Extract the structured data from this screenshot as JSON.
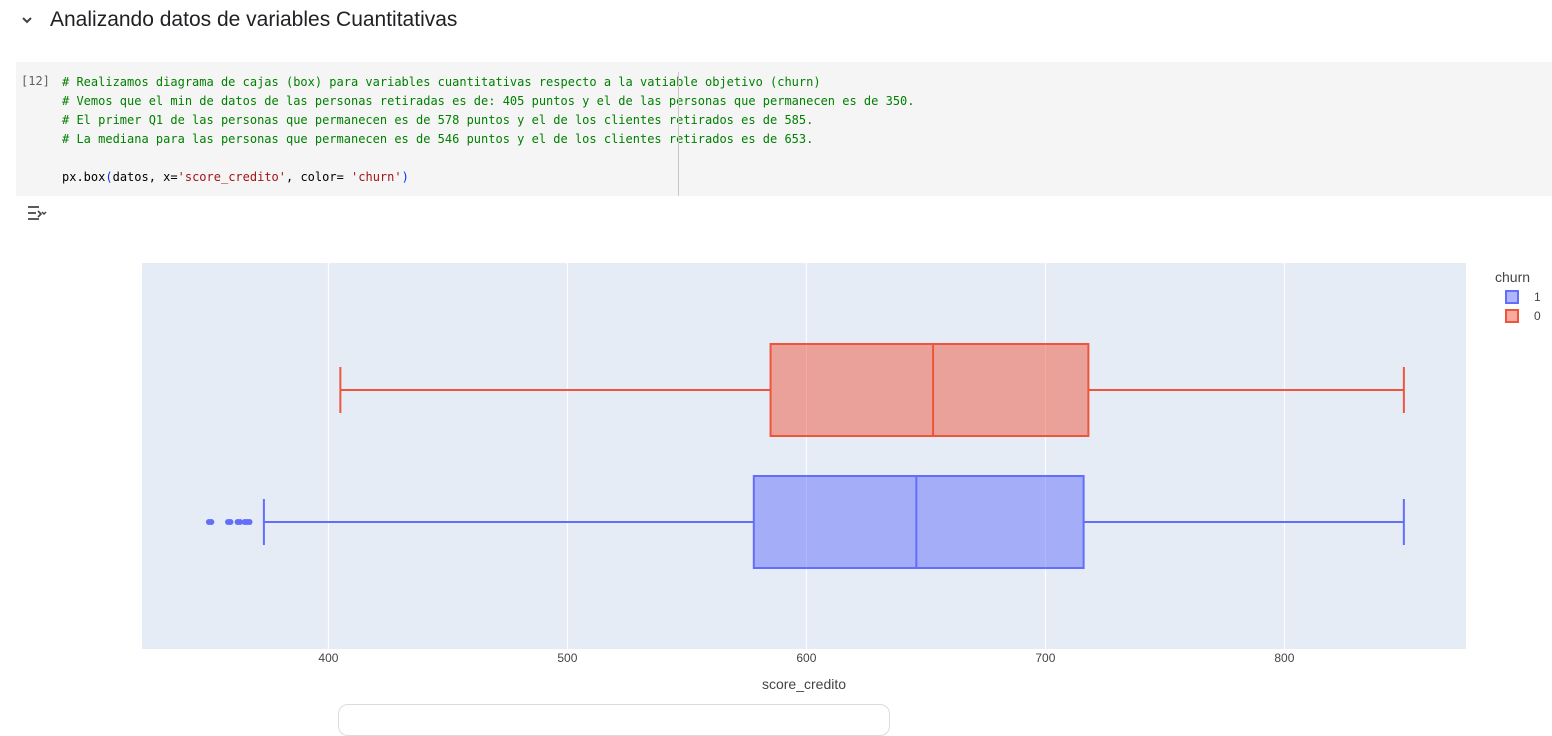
{
  "section": {
    "title": "Analizando datos de variables Cuantitativas",
    "toggle_icon": "chevron-down-icon"
  },
  "cell": {
    "execution_count": "[12]",
    "code_lines": [
      {
        "comment": "# Realizamos diagrama de cajas (box) para variables cuantitativas respecto a la vatiable objetivo (churn)"
      },
      {
        "comment": "# Vemos que el min de datos de las personas retiradas es de: 405 puntos y el de las personas que permanecen es de 350."
      },
      {
        "comment": "# El primer Q1 de las personas que permanecen es de 578 puntos y el de los clientes retirados es de 585."
      },
      {
        "comment": "# La mediana para las personas que permanecen es de 546 puntos y el de los clientes retirados es de 653."
      },
      {
        "comment": ""
      },
      {
        "tokens": [
          {
            "t": "px.box",
            "c": "plain"
          },
          {
            "t": "(",
            "c": "par"
          },
          {
            "t": "datos, x=",
            "c": "plain"
          },
          {
            "t": "'score_credito'",
            "c": "str"
          },
          {
            "t": ", color= ",
            "c": "plain"
          },
          {
            "t": "'churn'",
            "c": "str"
          },
          {
            "t": ")",
            "c": "par"
          }
        ]
      }
    ]
  },
  "output": {
    "toggle_icon": "output-toggle-icon"
  },
  "chart_data": {
    "type": "box",
    "orientation": "horizontal",
    "xlabel": "score_credito",
    "ylabel": "",
    "xlim": [
      322,
      876
    ],
    "x_ticks": [
      400,
      500,
      600,
      700,
      800
    ],
    "grid": true,
    "legend_title": "churn",
    "legend_position": "top-right",
    "series": [
      {
        "name": "1",
        "color": "#636efa",
        "fill": "rgba(99,110,250,0.5)",
        "whisker_low": 373,
        "q1": 578,
        "median": 646,
        "q3": 716,
        "whisker_high": 850,
        "outliers": [
          350,
          351,
          358,
          359,
          362,
          363,
          365,
          366,
          367
        ]
      },
      {
        "name": "0",
        "color": "#ef553b",
        "fill": "rgba(239,85,59,0.5)",
        "whisker_low": 405,
        "q1": 585,
        "median": 653,
        "q3": 718,
        "whisker_high": 850,
        "outliers": []
      }
    ],
    "plot_background": "#e5ecf6"
  }
}
